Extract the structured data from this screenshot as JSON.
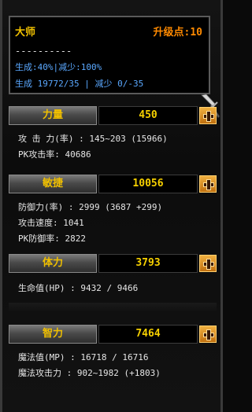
{
  "header": {
    "title": "大师",
    "upgrade_points": "升级点:10",
    "dashes": "----------",
    "line1": "生成:40%|减少:100%",
    "line2": "生成 19772/35 | 减少 0/-35"
  },
  "stats": [
    {
      "name": "力量",
      "value": "450",
      "info": [
        "攻 击 力(率) : 145~203 (15966)",
        "PK攻击率: 40686"
      ]
    },
    {
      "name": "敏捷",
      "value": "10056",
      "info": [
        "防御力(率) : 2999 (3687 +299)",
        "攻击速度: 1041",
        "PK防御率: 2822"
      ]
    },
    {
      "name": "体力",
      "value": "3793",
      "info": [
        "生命值(HP) : 9432 / 9466"
      ]
    },
    {
      "name": "智力",
      "value": "7464",
      "info": [
        "魔法值(MP) : 16718 / 16716",
        "魔法攻击力 : 902~1982 (+1803)"
      ]
    }
  ],
  "colors": {
    "title": "#f0c000",
    "points": "#ff8a00",
    "info_blue": "#5aa8ff",
    "stat_value": "#f6d000"
  },
  "icons": {
    "plus": "plus-icon",
    "sword": "sword-icon"
  }
}
